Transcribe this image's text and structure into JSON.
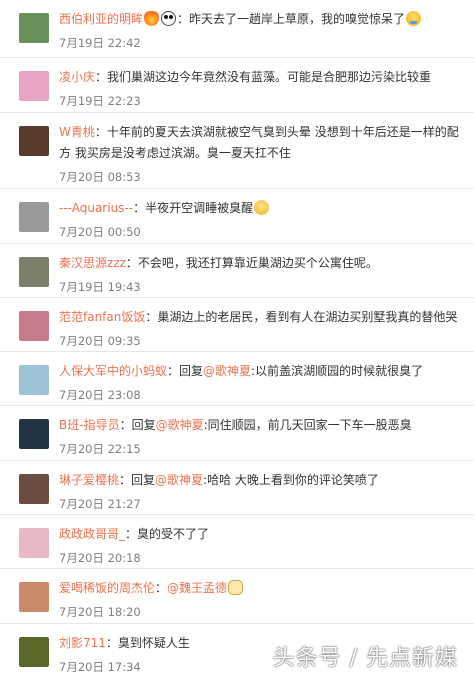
{
  "comments": [
    {
      "name": "西伯利亚的明眸",
      "text": "：昨天去了一趟岸上草原，我的嗅觉惊呆了",
      "time": "7月19日 22:42",
      "avatar_color": "#6a8f5c"
    },
    {
      "name": "凌小庆",
      "text": "：我们巢湖这边今年竟然没有蓝藻。可能是合肥那边污染比较重",
      "time": "7月19日 22:23",
      "avatar_color": "#e9a3c4"
    },
    {
      "name": "W青桃",
      "text": "：十年前的夏天去滨湖就被空气臭到头晕 没想到十年后还是一样的配方 我买房是没考虑过滨湖。臭一夏天扛不住",
      "time": "7月20日 08:53",
      "avatar_color": "#5a3a2a"
    },
    {
      "name": "---Aquarius--",
      "text": "：半夜开空调睡被臭醒",
      "time": "7月20日 00:50",
      "avatar_color": "#9a9a9a"
    },
    {
      "name": "秦汉思源zzz",
      "text": "：不会吧，我还打算靠近巢湖边买个公寓住呢。",
      "time": "7月19日 19:43",
      "avatar_color": "#7d7f6a"
    },
    {
      "name": "范范fanfan饭饭",
      "text": "：巢湖边上的老居民，看到有人在湖边买别墅我真的替他哭",
      "time": "7月20日 09:35",
      "avatar_color": "#c77a8a"
    },
    {
      "name": "人保大军中的小蚂蚁",
      "text_pre": "：回复",
      "mention": "@歌神夏",
      "text_post": ":以前盖滨湖顺园的时候就很臭了",
      "time": "7月20日 23:08",
      "avatar_color": "#9fc2d6"
    },
    {
      "name": "B班-指导员",
      "text_pre": "：回复",
      "mention": "@歌神夏",
      "text_post": ":同住顺园，前几天回家一下车一股恶臭",
      "time": "7月20日 22:15",
      "avatar_color": "#223344"
    },
    {
      "name": "琳子爱樱桃",
      "text_pre": "：回复",
      "mention": "@歌神夏",
      "text_post": ":哈哈 大晚上看到你的评论笑喷了",
      "time": "7月20日 21:27",
      "avatar_color": "#6b4d44"
    },
    {
      "name": "政政政哥哥_",
      "text": "：臭的受不了了",
      "time": "7月20日 20:18",
      "avatar_color": "#e8b9c2"
    },
    {
      "name": "爱喝稀饭的周杰伦",
      "text_pre": "：",
      "mention": "@魏王孟德",
      "text_post": "",
      "time": "7月20日 18:20",
      "avatar_color": "#c98a6a"
    },
    {
      "name": "刘影711",
      "text": "：臭到怀疑人生",
      "time": "7月20日 17:34",
      "avatar_color": "#5a6a2a"
    }
  ],
  "watermark": "头条号 / 先点新媒",
  "colors": {
    "name": "#eb7350",
    "text": "#333333",
    "time": "#808080",
    "divider": "#e6e6e6"
  }
}
